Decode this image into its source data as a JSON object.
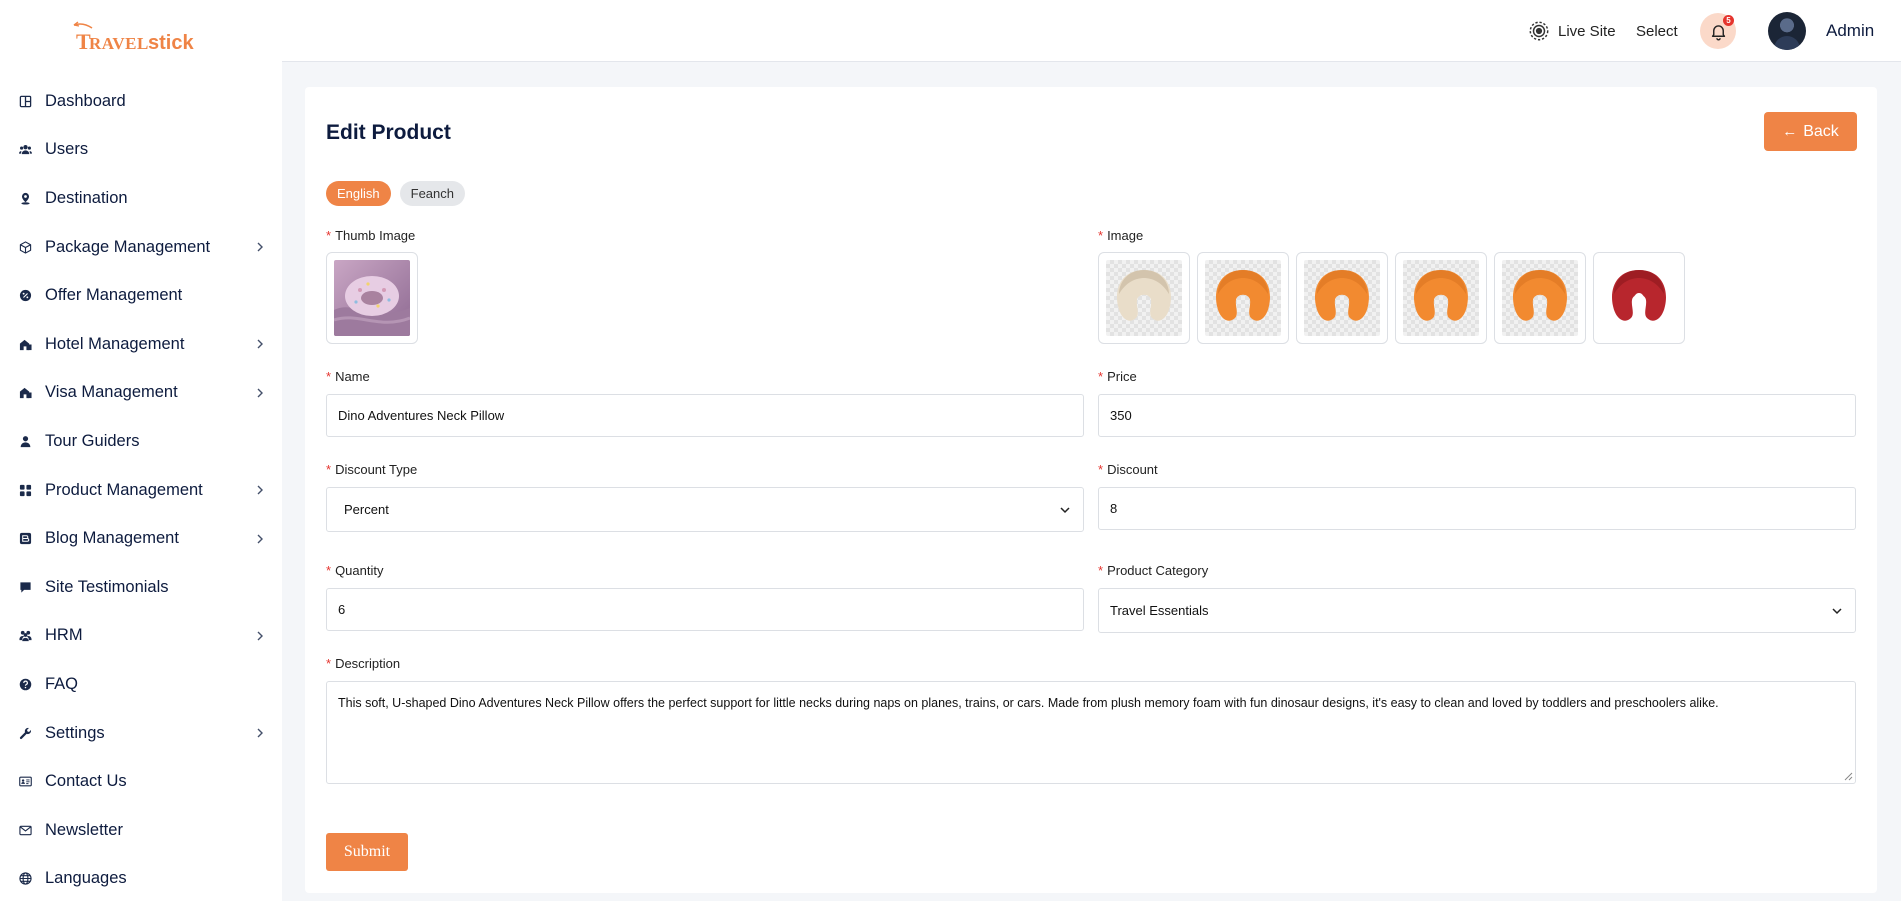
{
  "brand": {
    "logo_text": "TRAVELstick",
    "accent": "#ef8446",
    "text_color": "#0d1b3e"
  },
  "sidebar": {
    "items": [
      {
        "label": "Dashboard",
        "icon": "dashboard-icon",
        "has_submenu": false
      },
      {
        "label": "Users",
        "icon": "users-icon",
        "has_submenu": false
      },
      {
        "label": "Destination",
        "icon": "map-pin-icon",
        "has_submenu": false
      },
      {
        "label": "Package Management",
        "icon": "package-icon",
        "has_submenu": true
      },
      {
        "label": "Offer Management",
        "icon": "offer-badge-icon",
        "has_submenu": false
      },
      {
        "label": "Hotel Management",
        "icon": "hotel-icon",
        "has_submenu": true
      },
      {
        "label": "Visa Management",
        "icon": "visa-icon",
        "has_submenu": true
      },
      {
        "label": "Tour Guiders",
        "icon": "user-icon",
        "has_submenu": false
      },
      {
        "label": "Product Management",
        "icon": "grid-icon",
        "has_submenu": true
      },
      {
        "label": "Blog Management",
        "icon": "blog-icon",
        "has_submenu": true
      },
      {
        "label": "Site Testimonials",
        "icon": "comment-icon",
        "has_submenu": false
      },
      {
        "label": "HRM",
        "icon": "team-icon",
        "has_submenu": true
      },
      {
        "label": "FAQ",
        "icon": "question-icon",
        "has_submenu": false
      },
      {
        "label": "Settings",
        "icon": "wrench-icon",
        "has_submenu": true
      },
      {
        "label": "Contact Us",
        "icon": "contact-card-icon",
        "has_submenu": false
      },
      {
        "label": "Newsletter",
        "icon": "mail-icon",
        "has_submenu": false
      },
      {
        "label": "Languages",
        "icon": "globe-icon",
        "has_submenu": false
      }
    ]
  },
  "topbar": {
    "live_site": "Live Site",
    "language_select": "Select",
    "notification_count": "5",
    "user_name": "Admin"
  },
  "page": {
    "title": "Edit Product",
    "back_label": "Back",
    "language_tabs": [
      {
        "label": "English",
        "active": true
      },
      {
        "label": "Feanch",
        "active": false
      }
    ]
  },
  "form": {
    "thumb_image_label": "Thumb Image",
    "image_label": "Image",
    "images": [
      {
        "icon": "neck-pillow-cream-icon"
      },
      {
        "icon": "neck-pillow-orange-icon"
      },
      {
        "icon": "neck-pillow-orange-icon"
      },
      {
        "icon": "neck-pillow-orange-icon"
      },
      {
        "icon": "neck-pillow-orange-icon"
      },
      {
        "icon": "neck-pillow-red-icon"
      }
    ],
    "name_label": "Name",
    "name_value": "Dino Adventures Neck Pillow",
    "price_label": "Price",
    "price_value": "350",
    "discount_type_label": "Discount Type",
    "discount_type_value": "Percent",
    "discount_label": "Discount",
    "discount_value": "8",
    "quantity_label": "Quantity",
    "quantity_value": "6",
    "category_label": "Product Category",
    "category_value": "Travel Essentials",
    "description_label": "Description",
    "description_value": "This soft, U-shaped Dino Adventures Neck Pillow offers the perfect support for little necks during naps on planes, trains, or cars. Made from plush memory foam with fun dinosaur designs, it's easy to clean and loved by toddlers and preschoolers alike.",
    "submit_label": "Submit"
  }
}
